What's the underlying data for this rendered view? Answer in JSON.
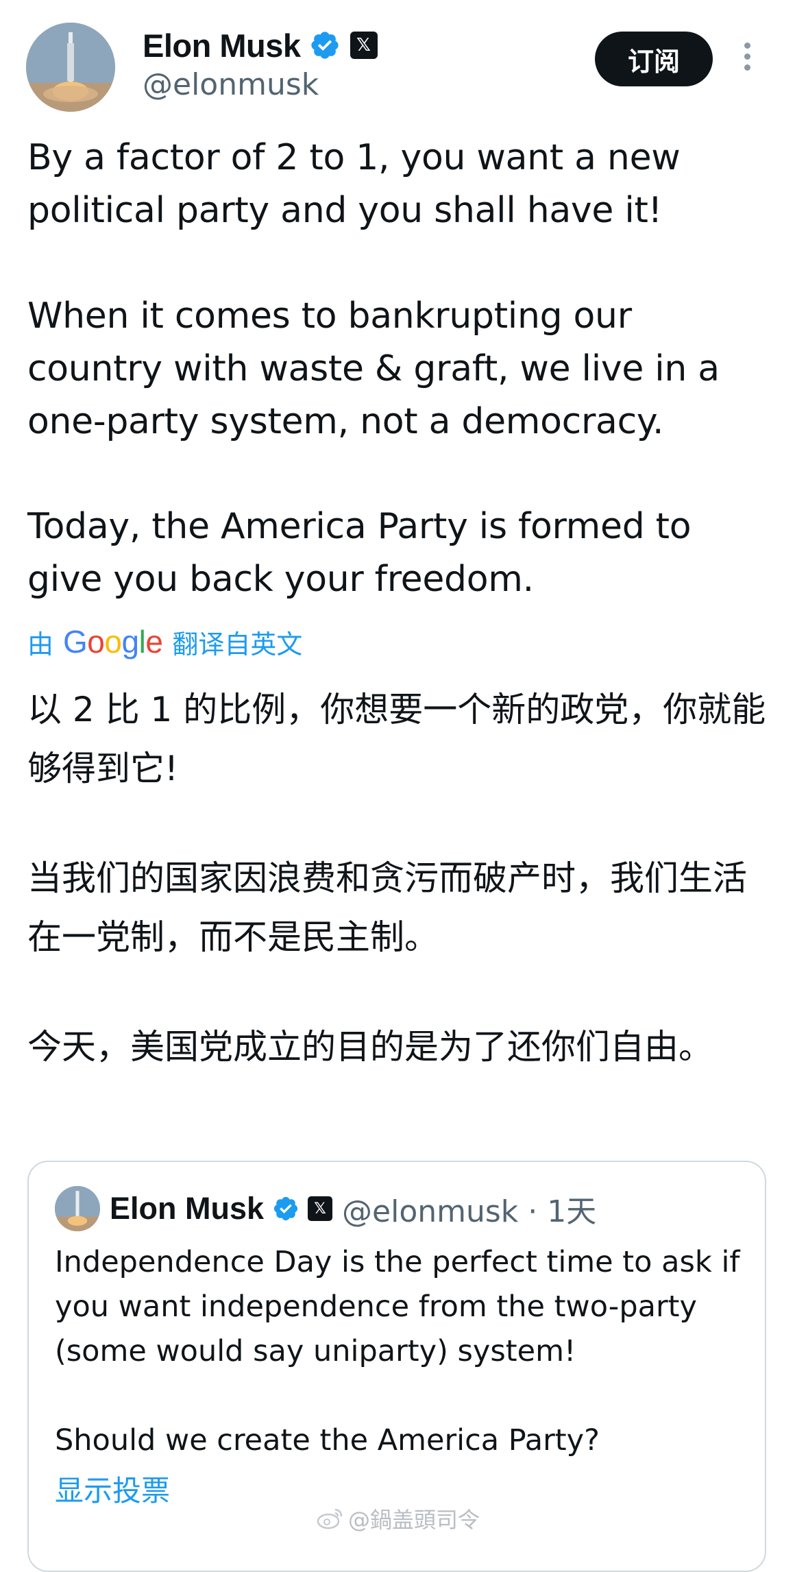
{
  "author": {
    "name": "Elon Musk",
    "handle": "@elonmusk",
    "avatar_icon": "rocket-launch-avatar",
    "verified_color": "#1d9bf0"
  },
  "actions": {
    "subscribe_label": "订阅",
    "more_icon": "more-vertical-icon"
  },
  "tweet": {
    "paragraphs_en": [
      "By a factor of 2 to 1, you want a new political party and you shall have it!",
      "When it comes to bankrupting our country with waste & graft, we live in a one-party system, not a democracy.",
      "Today, the America Party is formed to give you back your freedom."
    ],
    "translation": {
      "prefix": "由",
      "provider": "Google",
      "suffix": "翻译自英文"
    },
    "paragraphs_zh": [
      "以 2 比 1 的比例，你想要一个新的政党，你就能够得到它!",
      "当我们的国家因浪费和贪污而破产时，我们生活在一党制，而不是民主制。",
      "今天，美国党成立的目的是为了还你们自由。"
    ]
  },
  "quoted_tweet": {
    "name": "Elon Musk",
    "handle_time": "@elonmusk · 1天",
    "text": "Independence Day is the perfect time to ask if you want independence from the two-party (some would say uniparty) system!",
    "question": "Should we create the America Party?",
    "show_poll": "显示投票"
  },
  "watermark": "@鍋盖頭司令"
}
